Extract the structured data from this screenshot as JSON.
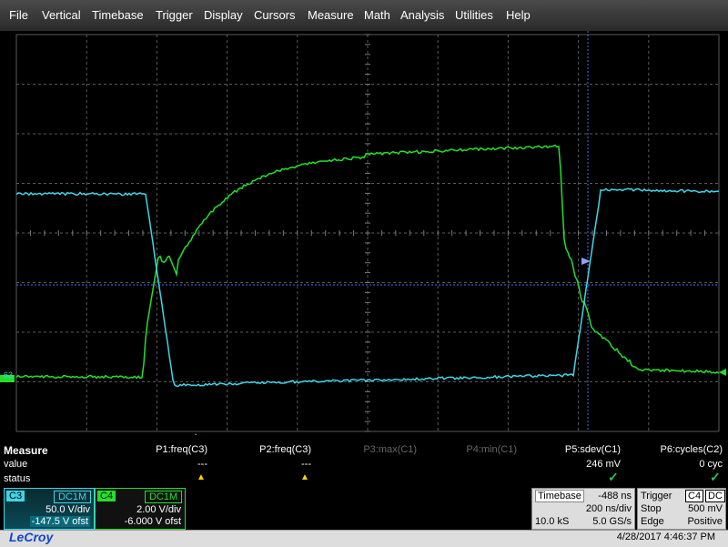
{
  "menu": [
    "File",
    "Vertical",
    "Timebase",
    "Trigger",
    "Display",
    "Cursors",
    "Measure",
    "Math",
    "Analysis",
    "Utilities",
    "Help"
  ],
  "measure": {
    "title": "Measure",
    "row_value": "value",
    "row_status": "status",
    "params": [
      {
        "label": "P1:freq(C3)",
        "value": "---",
        "status": "warn"
      },
      {
        "label": "P2:freq(C3)",
        "value": "---",
        "status": "warn"
      },
      {
        "label": "P3:max(C1)",
        "value": "",
        "status": "none"
      },
      {
        "label": "P4:min(C1)",
        "value": "",
        "status": "none"
      },
      {
        "label": "P5:sdev(C1)",
        "value": "246 mV",
        "status": "ok"
      },
      {
        "label": "P6:cycles(C2)",
        "value": "0 cyc",
        "status": "ok"
      }
    ]
  },
  "channels": [
    {
      "tag": "C3",
      "coupling": "DC1M",
      "vdiv": "50.0 V/div",
      "offset": "-147.5 V ofst"
    },
    {
      "tag": "C4",
      "coupling": "DC1M",
      "vdiv": "2.00 V/div",
      "offset": "-6.000 V ofst"
    }
  ],
  "timebase": {
    "label": "Timebase",
    "delay": "-488 ns",
    "tdiv": "200 ns/div",
    "samples": "10.0 kS",
    "rate": "5.0 GS/s"
  },
  "trigger": {
    "label": "Trigger",
    "channel": "C4",
    "coupling": "DC",
    "mode": "Stop",
    "level": "500 mV",
    "type": "Edge",
    "slope": "Positive"
  },
  "statusbar": {
    "logo": "LeCroy",
    "datetime": "4/28/2017 4:46:37 PM"
  },
  "scope": {
    "ground_marker": "63"
  },
  "colors": {
    "c3": "#3dd6e8",
    "c4": "#22e02a",
    "grid": "#6a6a6a",
    "cursor": "#4a6cff"
  }
}
